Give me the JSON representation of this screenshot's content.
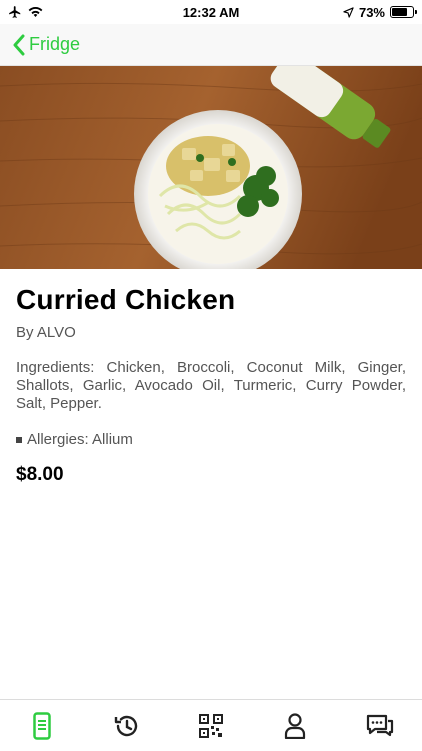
{
  "status_bar": {
    "time": "12:32 AM",
    "battery_percent": "73%",
    "battery_level": 0.73,
    "icons": [
      "airplane-icon",
      "wifi-icon",
      "location-arrow-icon",
      "battery-icon"
    ]
  },
  "nav": {
    "back_label": "Fridge",
    "back_icon": "chevron-left-icon"
  },
  "colors": {
    "accent": "#2ecc40",
    "text_primary": "#000000",
    "text_secondary": "#555555"
  },
  "product": {
    "title": "Curried Chicken",
    "byline": "By ALVO",
    "ingredients": "Ingredients: Chicken, Broccoli, Coconut Milk, Ginger, Shallots, Garlic, Avocado Oil, Turmeric, Curry Powder, Salt, Pepper.",
    "allergies": "Allergies: Allium",
    "price": "$8.00"
  },
  "tab_bar": {
    "tabs": [
      {
        "icon": "fridge-icon",
        "active": true
      },
      {
        "icon": "history-icon",
        "active": false
      },
      {
        "icon": "qr-code-icon",
        "active": false
      },
      {
        "icon": "profile-icon",
        "active": false
      },
      {
        "icon": "chat-icon",
        "active": false
      }
    ]
  }
}
